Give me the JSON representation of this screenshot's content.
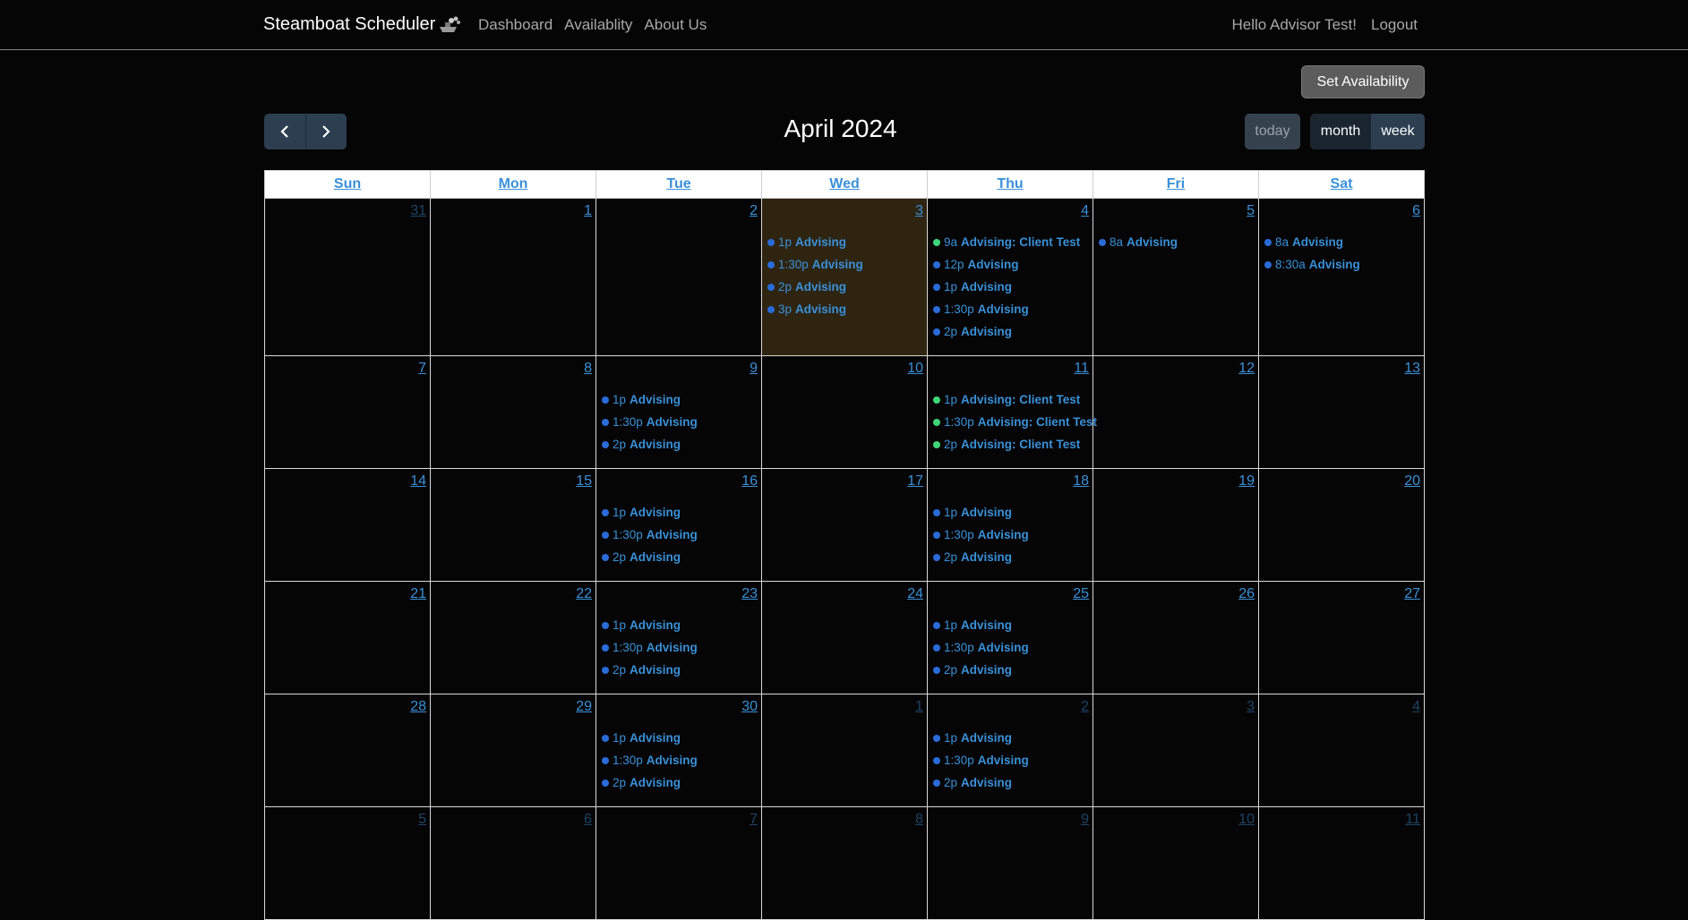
{
  "navbar": {
    "brand": "Steamboat Scheduler",
    "links": [
      "Dashboard",
      "Availablity",
      "About Us"
    ],
    "greeting": "Hello Advisor Test!",
    "logout": "Logout"
  },
  "set_availability": "Set Availability",
  "calendar": {
    "title": "April 2024",
    "today_label": "today",
    "month_label": "month",
    "week_label": "week",
    "day_headers": [
      "Sun",
      "Mon",
      "Tue",
      "Wed",
      "Thu",
      "Fri",
      "Sat"
    ],
    "today_date": "3",
    "weeks": [
      [
        {
          "day": "31",
          "other": true,
          "events": []
        },
        {
          "day": "1",
          "events": []
        },
        {
          "day": "2",
          "events": []
        },
        {
          "day": "3",
          "today": true,
          "events": [
            {
              "time": "1p",
              "title": "Advising"
            },
            {
              "time": "1:30p",
              "title": "Advising"
            },
            {
              "time": "2p",
              "title": "Advising"
            },
            {
              "time": "3p",
              "title": "Advising"
            }
          ]
        },
        {
          "day": "4",
          "events": [
            {
              "time": "9a",
              "title": "Advising: Client Test",
              "booked": true
            },
            {
              "time": "12p",
              "title": "Advising"
            },
            {
              "time": "1p",
              "title": "Advising"
            },
            {
              "time": "1:30p",
              "title": "Advising"
            },
            {
              "time": "2p",
              "title": "Advising"
            }
          ]
        },
        {
          "day": "5",
          "events": [
            {
              "time": "8a",
              "title": "Advising"
            }
          ]
        },
        {
          "day": "6",
          "events": [
            {
              "time": "8a",
              "title": "Advising"
            },
            {
              "time": "8:30a",
              "title": "Advising"
            }
          ]
        }
      ],
      [
        {
          "day": "7",
          "events": []
        },
        {
          "day": "8",
          "events": []
        },
        {
          "day": "9",
          "events": [
            {
              "time": "1p",
              "title": "Advising"
            },
            {
              "time": "1:30p",
              "title": "Advising"
            },
            {
              "time": "2p",
              "title": "Advising"
            }
          ]
        },
        {
          "day": "10",
          "events": []
        },
        {
          "day": "11",
          "events": [
            {
              "time": "1p",
              "title": "Advising: Client Test",
              "booked": true
            },
            {
              "time": "1:30p",
              "title": "Advising: Client Test",
              "booked": true
            },
            {
              "time": "2p",
              "title": "Advising: Client Test",
              "booked": true
            }
          ]
        },
        {
          "day": "12",
          "events": []
        },
        {
          "day": "13",
          "events": []
        }
      ],
      [
        {
          "day": "14",
          "events": []
        },
        {
          "day": "15",
          "events": []
        },
        {
          "day": "16",
          "events": [
            {
              "time": "1p",
              "title": "Advising"
            },
            {
              "time": "1:30p",
              "title": "Advising"
            },
            {
              "time": "2p",
              "title": "Advising"
            }
          ]
        },
        {
          "day": "17",
          "events": []
        },
        {
          "day": "18",
          "events": [
            {
              "time": "1p",
              "title": "Advising"
            },
            {
              "time": "1:30p",
              "title": "Advising"
            },
            {
              "time": "2p",
              "title": "Advising"
            }
          ]
        },
        {
          "day": "19",
          "events": []
        },
        {
          "day": "20",
          "events": []
        }
      ],
      [
        {
          "day": "21",
          "events": []
        },
        {
          "day": "22",
          "events": []
        },
        {
          "day": "23",
          "events": [
            {
              "time": "1p",
              "title": "Advising"
            },
            {
              "time": "1:30p",
              "title": "Advising"
            },
            {
              "time": "2p",
              "title": "Advising"
            }
          ]
        },
        {
          "day": "24",
          "events": []
        },
        {
          "day": "25",
          "events": [
            {
              "time": "1p",
              "title": "Advising"
            },
            {
              "time": "1:30p",
              "title": "Advising"
            },
            {
              "time": "2p",
              "title": "Advising"
            }
          ]
        },
        {
          "day": "26",
          "events": []
        },
        {
          "day": "27",
          "events": []
        }
      ],
      [
        {
          "day": "28",
          "events": []
        },
        {
          "day": "29",
          "events": []
        },
        {
          "day": "30",
          "events": [
            {
              "time": "1p",
              "title": "Advising"
            },
            {
              "time": "1:30p",
              "title": "Advising"
            },
            {
              "time": "2p",
              "title": "Advising"
            }
          ]
        },
        {
          "day": "1",
          "other": true,
          "events": []
        },
        {
          "day": "2",
          "other": true,
          "events": [
            {
              "time": "1p",
              "title": "Advising"
            },
            {
              "time": "1:30p",
              "title": "Advising"
            },
            {
              "time": "2p",
              "title": "Advising"
            }
          ]
        },
        {
          "day": "3",
          "other": true,
          "events": []
        },
        {
          "day": "4",
          "other": true,
          "events": []
        }
      ],
      [
        {
          "day": "5",
          "other": true,
          "events": []
        },
        {
          "day": "6",
          "other": true,
          "events": []
        },
        {
          "day": "7",
          "other": true,
          "events": []
        },
        {
          "day": "8",
          "other": true,
          "events": []
        },
        {
          "day": "9",
          "other": true,
          "events": []
        },
        {
          "day": "10",
          "other": true,
          "events": []
        },
        {
          "day": "11",
          "other": true,
          "events": []
        }
      ]
    ]
  },
  "colors": {
    "available_dot": "#2a6bd8",
    "booked_dot": "#3fd67a",
    "today_bg": "#2e2410",
    "link": "#3a90d8"
  }
}
